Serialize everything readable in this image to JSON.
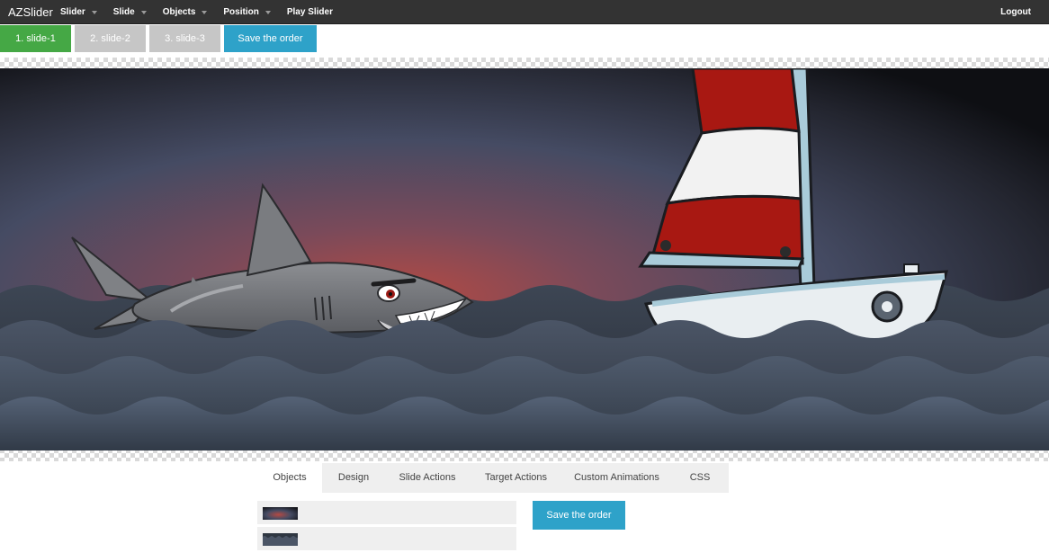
{
  "navbar": {
    "brand": "AZSlider",
    "menu": [
      {
        "label": "Slider",
        "has_caret": true
      },
      {
        "label": "Slide",
        "has_caret": true
      },
      {
        "label": "Objects",
        "has_caret": true
      },
      {
        "label": "Position",
        "has_caret": true
      },
      {
        "label": "Play Slider",
        "has_caret": false
      }
    ],
    "logout": "Logout"
  },
  "slides": {
    "tabs": [
      {
        "label": "1. slide-1",
        "state": "active"
      },
      {
        "label": "2. slide-2",
        "state": "inactive"
      },
      {
        "label": "3. slide-3",
        "state": "inactive"
      }
    ],
    "save_label": "Save the order"
  },
  "editor": {
    "tabs": [
      "Objects",
      "Design",
      "Slide Actions",
      "Target Actions",
      "Custom Animations",
      "CSS"
    ],
    "active_tab": "Objects",
    "save_label": "Save the order"
  },
  "colors": {
    "navbar": "#333333",
    "active_slide": "#45a845",
    "inactive_slide": "#c6c6c6",
    "accent": "#2ea2c9"
  },
  "icons": {
    "caret": "caret-down-icon"
  }
}
